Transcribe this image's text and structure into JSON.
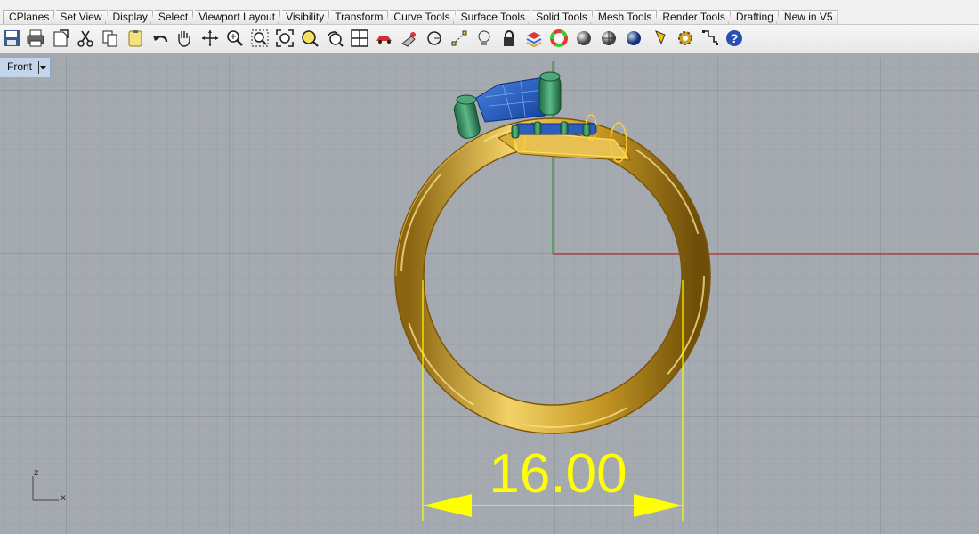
{
  "tabs": [
    "CPlanes",
    "Set View",
    "Display",
    "Select",
    "Viewport Layout",
    "Visibility",
    "Transform",
    "Curve Tools",
    "Surface Tools",
    "Solid Tools",
    "Mesh Tools",
    "Render Tools",
    "Drafting",
    "New in V5"
  ],
  "toolbar_icons": [
    "save-icon",
    "print-icon",
    "import-icon",
    "cut-icon",
    "copy-icon",
    "paste-icon",
    "undo-icon",
    "pan-icon",
    "rotate-view-icon",
    "zoom-dynamic-icon",
    "zoom-window-icon",
    "zoom-extents-icon",
    "zoom-selected-icon",
    "undo-view-icon",
    "four-viewports-icon",
    "car-icon",
    "settings-wrench-icon",
    "circle-icon",
    "point-edit-icon",
    "light-bulb-icon",
    "lock-icon",
    "layer-book-icon",
    "color-wheel-icon",
    "shaded-sphere-icon",
    "rendered-sphere-icon",
    "blue-sphere-icon",
    "analysis-icon",
    "options-gear-icon",
    "grid-snap-icon",
    "help-icon"
  ],
  "viewport": {
    "name": "Front",
    "dimension_label": "16.00",
    "axis_z": "z",
    "axis_x": "x"
  },
  "colors": {
    "grid_bg": "#a5aab0",
    "ring_gold": "#c8a02a",
    "stone_blue": "#1f5fc4",
    "prong_green": "#2e8b57",
    "dimension_yellow": "#ffff00",
    "x_axis": "#b03030",
    "y_axis": "#2f9a2f"
  }
}
